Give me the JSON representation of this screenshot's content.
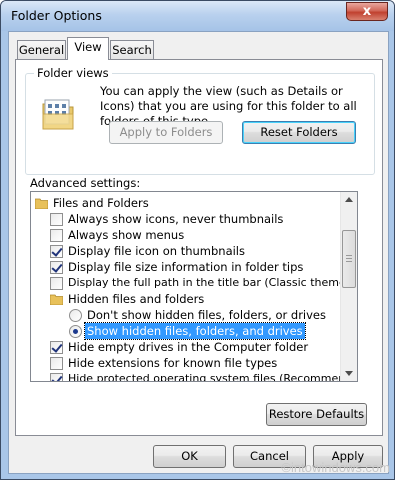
{
  "window": {
    "title": "Folder Options",
    "close_label": "x"
  },
  "tabs": [
    {
      "label": "General"
    },
    {
      "label": "View",
      "active": true
    },
    {
      "label": "Search"
    }
  ],
  "folder_views": {
    "group_label": "Folder views",
    "description": "You can apply the view (such as Details or Icons) that you are using for this folder to all folders of this type.",
    "apply_button": "Apply to Folders",
    "reset_button": "Reset Folders"
  },
  "advanced": {
    "label": "Advanced settings:",
    "items": [
      {
        "kind": "folder",
        "label": "Files and Folders"
      },
      {
        "kind": "checkbox",
        "checked": false,
        "label": "Always show icons, never thumbnails"
      },
      {
        "kind": "checkbox",
        "checked": false,
        "label": "Always show menus"
      },
      {
        "kind": "checkbox",
        "checked": true,
        "label": "Display file icon on thumbnails"
      },
      {
        "kind": "checkbox",
        "checked": true,
        "label": "Display file size information in folder tips"
      },
      {
        "kind": "checkbox",
        "checked": false,
        "label": "Display the full path in the title bar (Classic theme only)"
      },
      {
        "kind": "folder",
        "label": "Hidden files and folders"
      },
      {
        "kind": "radio",
        "selected": false,
        "label": "Don't show hidden files, folders, or drives"
      },
      {
        "kind": "radio",
        "selected": true,
        "label": "Show hidden files, folders, and drives"
      },
      {
        "kind": "checkbox",
        "checked": true,
        "label": "Hide empty drives in the Computer folder"
      },
      {
        "kind": "checkbox",
        "checked": false,
        "label": "Hide extensions for known file types"
      },
      {
        "kind": "checkbox",
        "checked": true,
        "label": "Hide protected operating system files (Recommended)"
      }
    ]
  },
  "restore_button": "Restore Defaults",
  "footer": {
    "ok": "OK",
    "cancel": "Cancel",
    "apply": "Apply"
  },
  "watermark": "©intowindows.com",
  "colors": {
    "selection": "#3399ff",
    "close_button": "#c0412f",
    "frame": "#a9c6e8"
  }
}
